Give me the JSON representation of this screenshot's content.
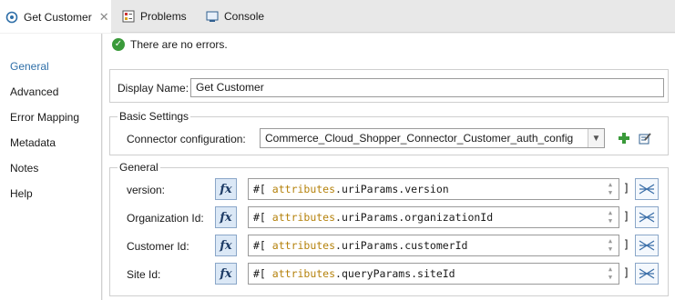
{
  "tabs": [
    {
      "label": "Get Customer",
      "icon": "flow-icon",
      "closable": true
    },
    {
      "label": "Problems",
      "icon": "problems-icon"
    },
    {
      "label": "Console",
      "icon": "console-icon"
    }
  ],
  "status": {
    "text": "There are no errors."
  },
  "nav": {
    "items": [
      {
        "label": "General",
        "active": true
      },
      {
        "label": "Advanced"
      },
      {
        "label": "Error Mapping"
      },
      {
        "label": "Metadata"
      },
      {
        "label": "Notes"
      },
      {
        "label": "Help"
      }
    ]
  },
  "display_name": {
    "label": "Display Name:",
    "value": "Get Customer"
  },
  "basic_settings": {
    "title": "Basic Settings",
    "connector_label": "Connector configuration:",
    "connector_value": "Commerce_Cloud_Shopper_Connector_Customer_auth_config"
  },
  "general": {
    "title": "General",
    "fields": [
      {
        "label": "version:",
        "prefix": "#[",
        "attr": "attributes",
        "rest": ".uriParams.version",
        "end": "]"
      },
      {
        "label": "Organization Id:",
        "prefix": "#[",
        "attr": "attributes",
        "rest": ".uriParams.organizationId",
        "end": "]"
      },
      {
        "label": "Customer Id:",
        "prefix": "#[",
        "attr": "attributes",
        "rest": ".uriParams.customerId",
        "end": "]"
      },
      {
        "label": "Site Id:",
        "prefix": "#[",
        "attr": "attributes",
        "rest": ".queryParams.siteId",
        "end": "]"
      }
    ],
    "fx_label": "fx"
  },
  "colors": {
    "accent": "#2f6fa8",
    "attribute_keyword": "#b5820c",
    "ok": "#3a9a3a"
  }
}
